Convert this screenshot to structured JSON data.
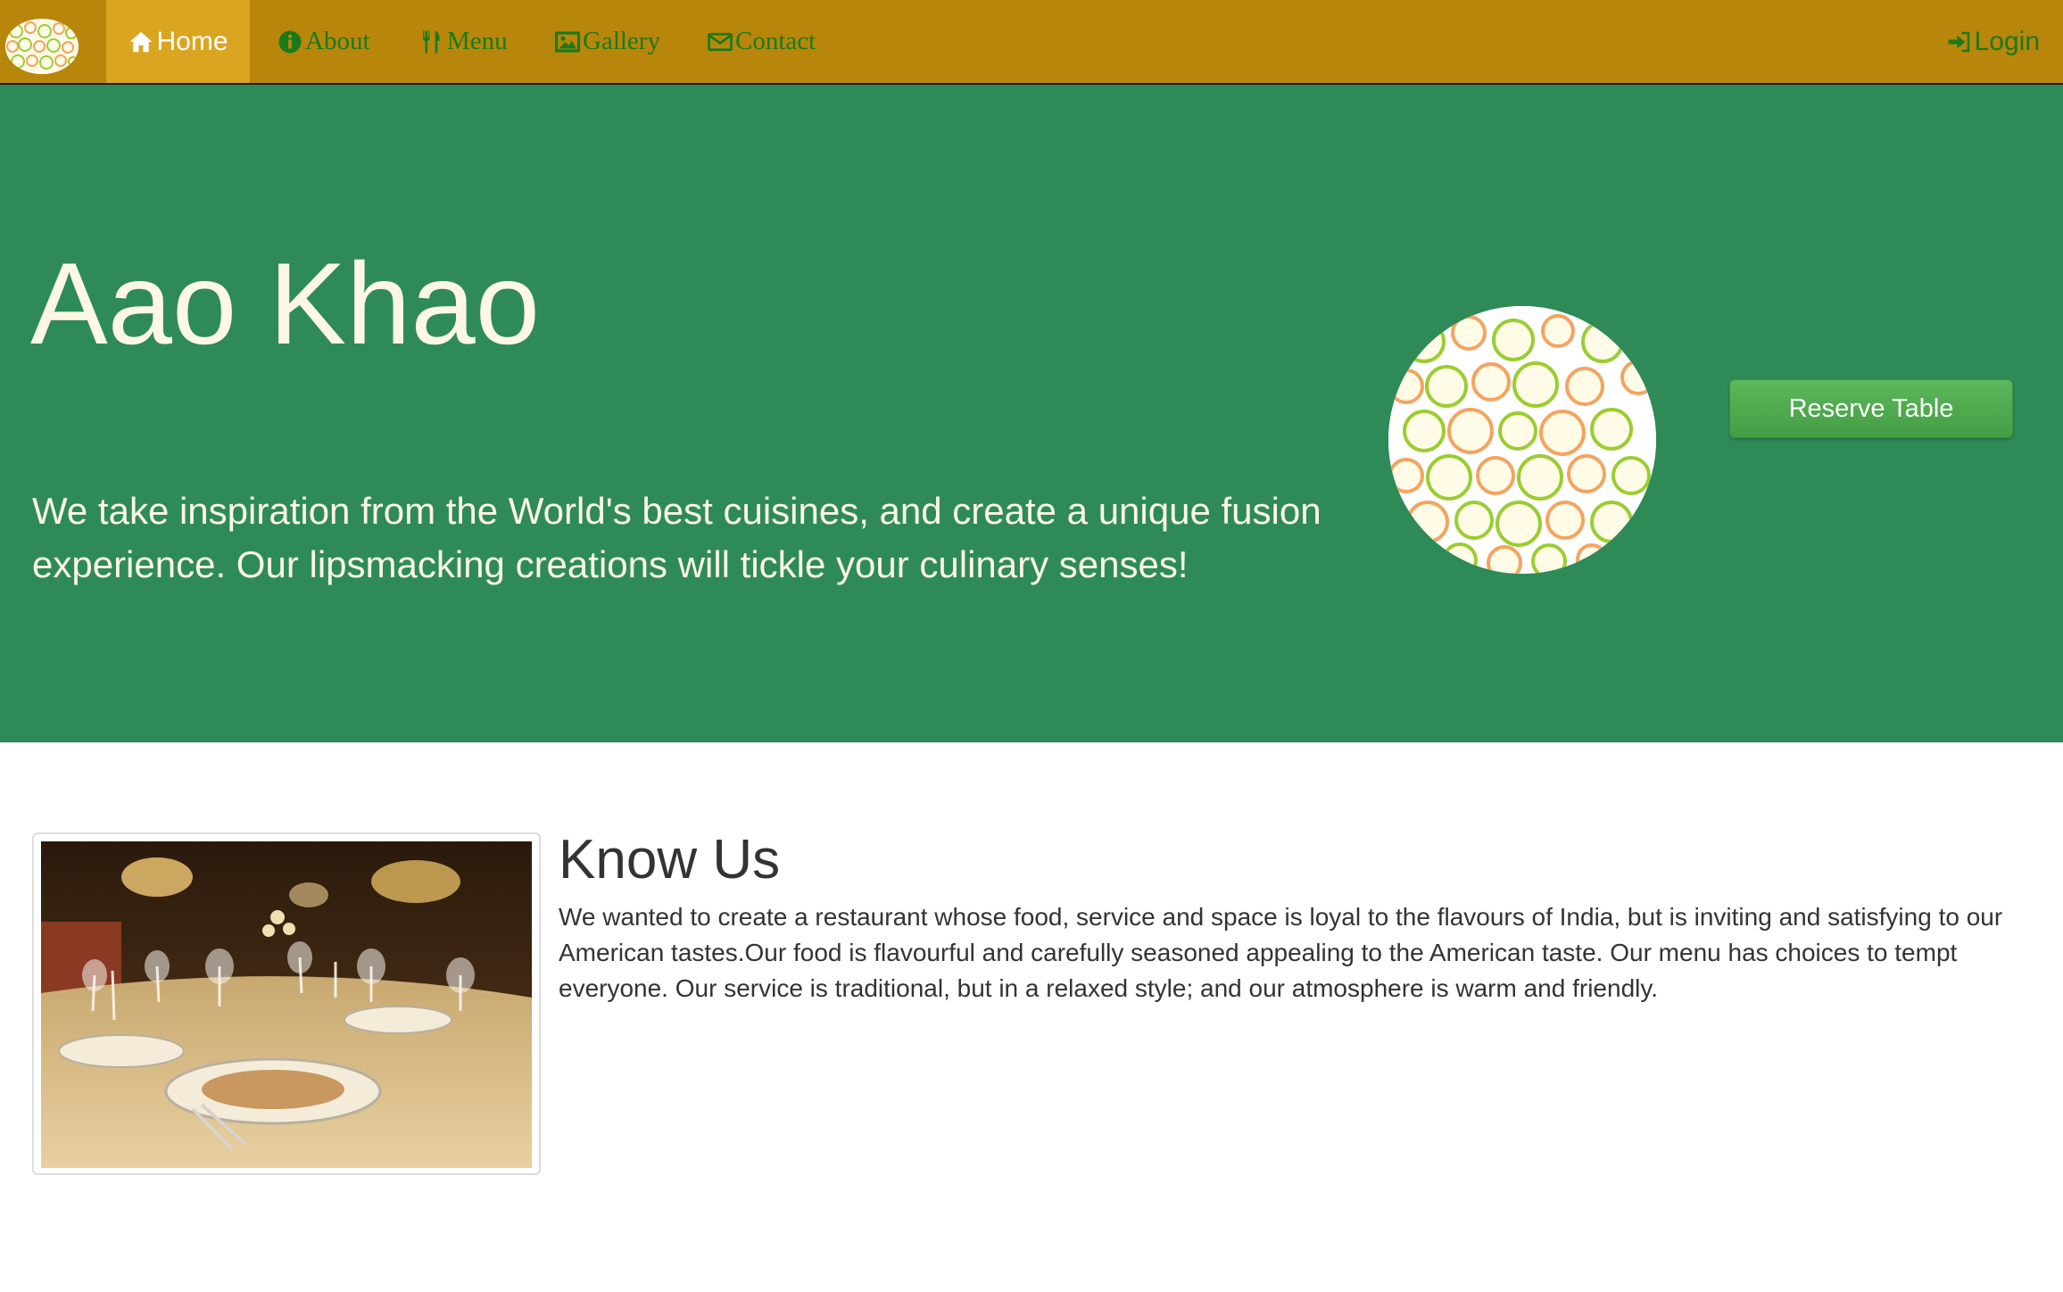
{
  "nav": {
    "home": "Home",
    "about": "About",
    "menu": "Menu",
    "gallery": "Gallery",
    "contact": "Contact",
    "login": "Login",
    "icons": [
      "home-icon",
      "info-icon",
      "cutlery-icon",
      "picture-icon",
      "envelope-icon",
      "login-icon"
    ]
  },
  "hero": {
    "title": "Aao Khao",
    "text": "We take inspiration from the World's best cuisines, and create a unique fusion experience. Our lipsmacking creations will tickle your culinary senses!",
    "button": "Reserve Table"
  },
  "about": {
    "title": "Know Us",
    "text": "We wanted to create a restaurant whose food, service and space is loyal to the flavours of India, but is inviting and satisfying to our American tastes.Our food is flavourful and carefully seasoned appealing to the American taste. Our menu has choices to tempt everyone. Our service is traditional, but in a relaxed style; and our atmosphere is warm and friendly."
  },
  "colors": {
    "navbar": "#b8860b",
    "nav_active": "#daa520",
    "nav_text": "#1a7a1a",
    "hero_bg": "#2e8b57",
    "hero_text": "#fdf7e4",
    "button": "#5cb85c"
  }
}
